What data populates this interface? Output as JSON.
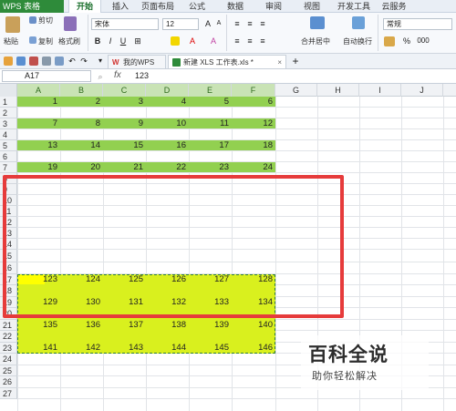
{
  "app": {
    "name": "WPS 表格"
  },
  "menu": [
    "开始",
    "插入",
    "页面布局",
    "公式",
    "数据",
    "审阅",
    "视图",
    "开发工具",
    "云服务"
  ],
  "ribbon": {
    "paste": "粘贴",
    "cut": "剪切",
    "copy": "复制",
    "format_painter": "格式刷",
    "font_name": "宋体",
    "font_size": "12",
    "merge_center": "合并居中",
    "wrap_text": "自动换行",
    "number_format": "常规",
    "percent": "%",
    "thousands": "000"
  },
  "tabs": {
    "my_wps": "我的WPS",
    "doc": "新建 XLS 工作表.xls *",
    "add": "+"
  },
  "formula_bar": {
    "name_box": "A17",
    "fx": "fx",
    "value": "123"
  },
  "columns": [
    "A",
    "B",
    "C",
    "D",
    "E",
    "F",
    "G",
    "H",
    "I",
    "J"
  ],
  "row_labels": [
    "1",
    "2",
    "3",
    "4",
    "5",
    "6",
    "7",
    "8",
    "9",
    "10",
    "11",
    "12",
    "13",
    "14",
    "15",
    "16",
    "17",
    "18",
    "19",
    "20",
    "21",
    "22",
    "23",
    "24",
    "25",
    "26",
    "27"
  ],
  "green_rows": [
    [
      1,
      2,
      3,
      4,
      5,
      6
    ],
    [
      7,
      8,
      9,
      10,
      11,
      12
    ],
    [
      13,
      14,
      15,
      16,
      17,
      18
    ],
    [
      19,
      20,
      21,
      22,
      23,
      24
    ]
  ],
  "pasted_rows": [
    [
      123,
      124,
      125,
      126,
      127,
      128
    ],
    [
      129,
      130,
      131,
      132,
      133,
      134
    ],
    [
      135,
      136,
      137,
      138,
      139,
      140
    ],
    [
      141,
      142,
      143,
      144,
      145,
      146
    ]
  ],
  "colors": {
    "green_fill": "#92d050",
    "yellow_fill": "#d9f01e",
    "highlight": "#e63b3b",
    "accent": "#2e8b3a"
  },
  "watermark": {
    "title": "百科全说",
    "subtitle": "助你轻松解决"
  }
}
